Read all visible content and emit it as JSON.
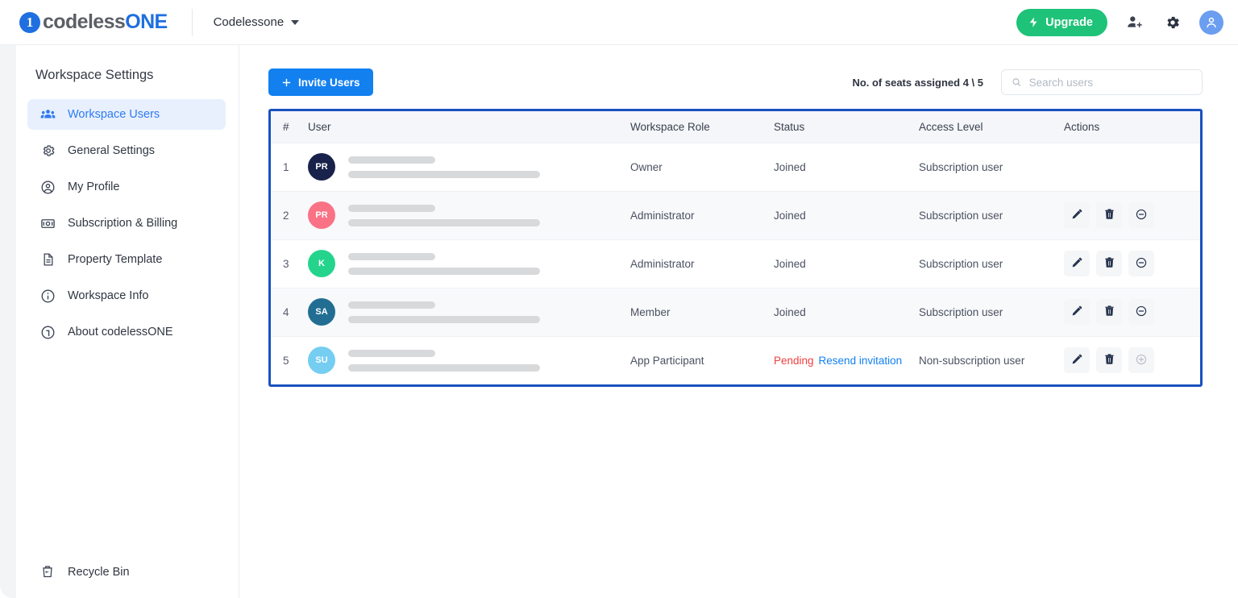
{
  "topbar": {
    "logo_text_a": "codeless",
    "logo_text_b": "ONE",
    "logo_mark": "one-badge-icon",
    "workspace_name": "Codelessone",
    "workspace_caret": "chevron-down-icon",
    "upgrade_label": "Upgrade",
    "upgrade_icon": "bolt-icon",
    "upgrade_color": "#1ec278",
    "add_user_icon": "add-user-icon",
    "settings_icon": "gear-icon",
    "account_icon": "user-avatar-icon",
    "account_color": "#6b9ef0"
  },
  "sidebar": {
    "title": "Workspace Settings",
    "items": [
      {
        "label": "Workspace Users",
        "icon": "people-group-icon",
        "active": true
      },
      {
        "label": "General Settings",
        "icon": "gear-icon",
        "active": false
      },
      {
        "label": "My Profile",
        "icon": "user-circle-icon",
        "active": false
      },
      {
        "label": "Subscription & Billing",
        "icon": "banknote-icon",
        "active": false
      },
      {
        "label": "Property Template",
        "icon": "document-icon",
        "active": false
      },
      {
        "label": "Workspace Info",
        "icon": "info-circle-icon",
        "active": false
      },
      {
        "label": "About codelessONE",
        "icon": "logo-circle-icon",
        "active": false
      }
    ],
    "footer": {
      "label": "Recycle Bin",
      "icon": "recycle-bin-icon"
    },
    "active_bg": "#e8f0fe",
    "active_color": "#2f7bf0"
  },
  "toolbar": {
    "invite_label": "Invite Users",
    "invite_icon": "plus-icon",
    "invite_color": "#1380f0",
    "seats_label": "No. of seats assigned 4 \\ 5",
    "search": {
      "icon": "search-icon",
      "placeholder": "Search users",
      "value": ""
    }
  },
  "table": {
    "border_color": "#1a51c0",
    "columns": [
      "#",
      "User",
      "Workspace Role",
      "Status",
      "Access Level",
      "Actions"
    ],
    "rows": [
      {
        "num": "1",
        "avatar_initials": "PR",
        "avatar_color": "#18224a",
        "role": "Owner",
        "status": "Joined",
        "status_color": "#4a5160",
        "resend_label": "",
        "access": "Subscription user",
        "actions": []
      },
      {
        "num": "2",
        "avatar_initials": "PR",
        "avatar_color": "#fa7285",
        "role": "Administrator",
        "status": "Joined",
        "status_color": "#4a5160",
        "resend_label": "",
        "access": "Subscription user",
        "actions": [
          "edit-icon",
          "delete-icon",
          "remove-seat-icon"
        ]
      },
      {
        "num": "3",
        "avatar_initials": "K",
        "avatar_color": "#25d48c",
        "role": "Administrator",
        "status": "Joined",
        "status_color": "#4a5160",
        "resend_label": "",
        "access": "Subscription user",
        "actions": [
          "edit-icon",
          "delete-icon",
          "remove-seat-icon"
        ]
      },
      {
        "num": "4",
        "avatar_initials": "SA",
        "avatar_color": "#226e93",
        "role": "Member",
        "status": "Joined",
        "status_color": "#4a5160",
        "resend_label": "",
        "access": "Subscription user",
        "actions": [
          "edit-icon",
          "delete-icon",
          "remove-seat-icon"
        ]
      },
      {
        "num": "5",
        "avatar_initials": "SU",
        "avatar_color": "#75cdf2",
        "role": "App Participant",
        "status": "Pending",
        "status_color": "#ef3f3f",
        "resend_label": "Resend invitation",
        "access": "Non-subscription user",
        "actions": [
          "edit-icon",
          "delete-icon",
          "add-seat-icon"
        ]
      }
    ]
  }
}
